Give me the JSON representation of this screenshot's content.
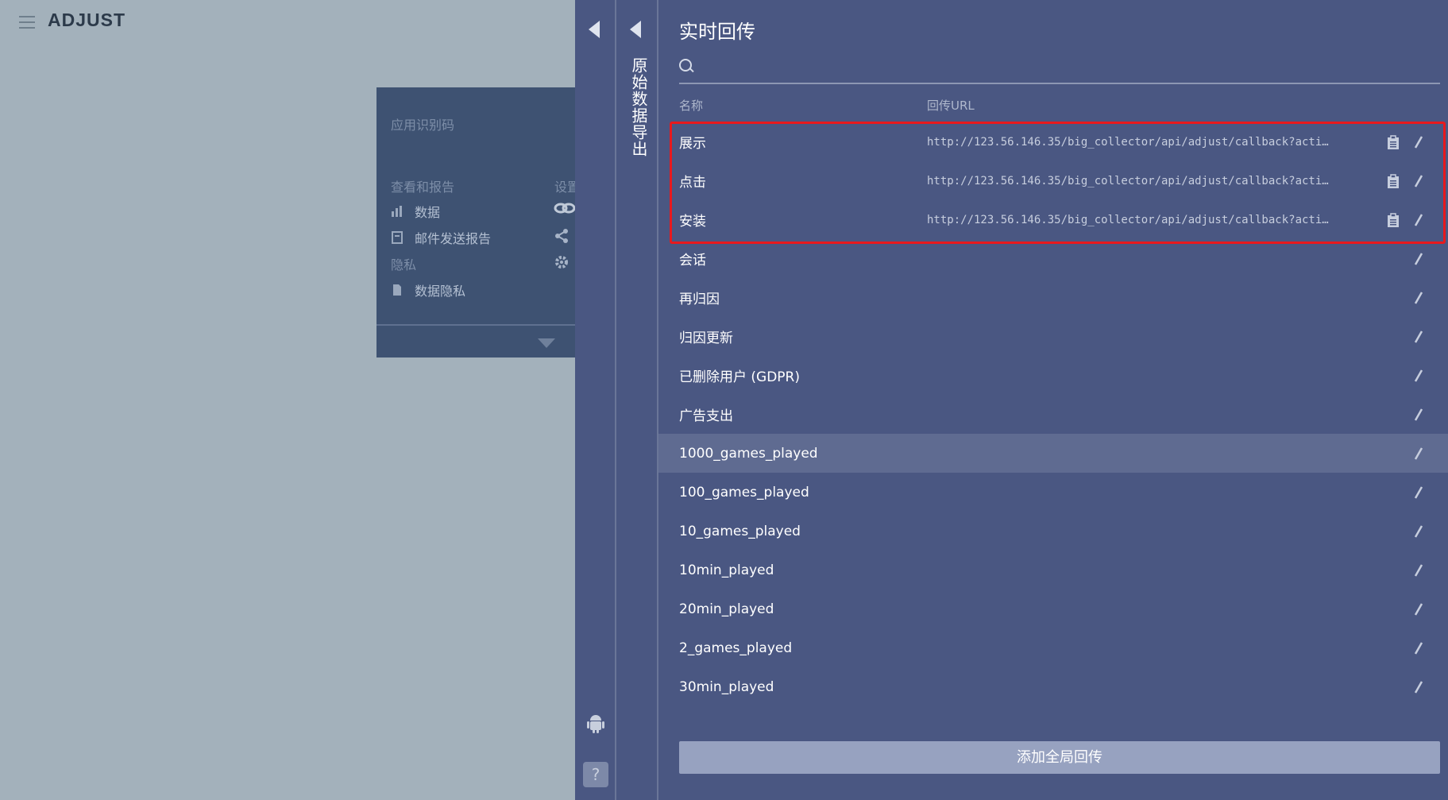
{
  "header": {
    "logo": "ADJUST"
  },
  "app_card": {
    "app_id_label": "应用识别码",
    "section_reports": "查看和报告",
    "section_settings": "设置",
    "items": [
      {
        "label": "数据",
        "icon": "bar-chart-icon"
      },
      {
        "label": "邮件发送报告",
        "icon": "report-icon"
      }
    ],
    "section_privacy": "隐私",
    "privacy_items": [
      {
        "label": "数据隐私",
        "icon": "document-icon"
      }
    ]
  },
  "side_panel": {
    "vertical_title": "原始数据导出"
  },
  "main": {
    "title": "实时回传",
    "search": {
      "placeholder": "",
      "value": ""
    },
    "columns": {
      "name": "名称",
      "url": "回传URL"
    },
    "rows": [
      {
        "name": "展示",
        "url": "http://123.56.146.35/big_collector/api/adjust/callback?acti…"
      },
      {
        "name": "点击",
        "url": "http://123.56.146.35/big_collector/api/adjust/callback?acti…"
      },
      {
        "name": "安装",
        "url": "http://123.56.146.35/big_collector/api/adjust/callback?acti…"
      },
      {
        "name": "会话",
        "url": ""
      },
      {
        "name": "再归因",
        "url": ""
      },
      {
        "name": "归因更新",
        "url": ""
      },
      {
        "name": "已删除用户 (GDPR)",
        "url": ""
      },
      {
        "name": "广告支出",
        "url": ""
      },
      {
        "name": "1000_games_played",
        "url": ""
      },
      {
        "name": "100_games_played",
        "url": ""
      },
      {
        "name": "10_games_played",
        "url": ""
      },
      {
        "name": "10min_played",
        "url": ""
      },
      {
        "name": "20min_played",
        "url": ""
      },
      {
        "name": "2_games_played",
        "url": ""
      },
      {
        "name": "30min_played",
        "url": ""
      },
      {
        "name": "",
        "url": ""
      }
    ],
    "add_button": "添加全局回传"
  },
  "colors": {
    "highlight_border": "#e8191d",
    "panel_bg": "#4a5782",
    "row_hover": "#5f6b91"
  }
}
